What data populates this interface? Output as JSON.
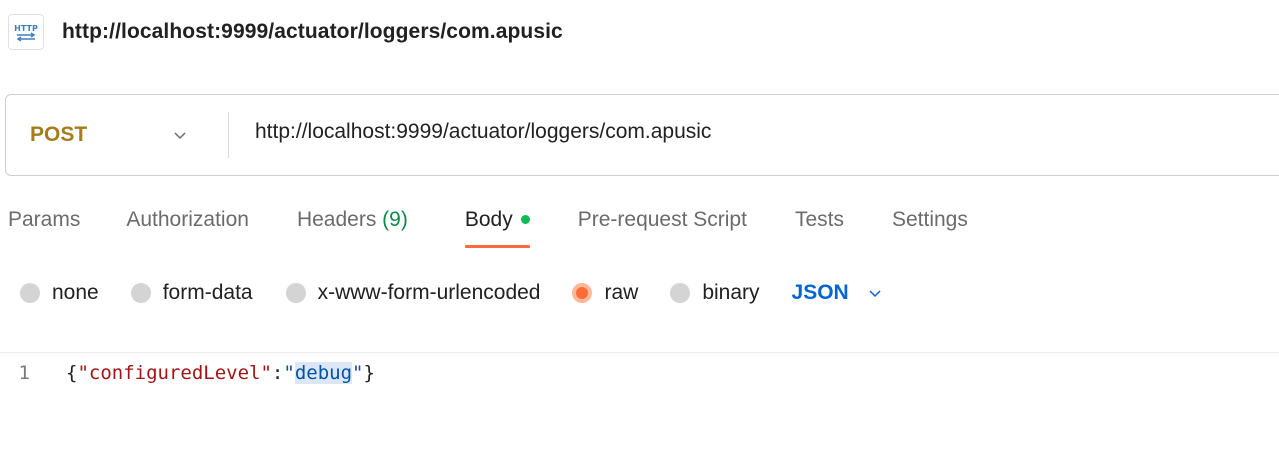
{
  "request": {
    "title": "http://localhost:9999/actuator/loggers/com.apusic",
    "icon": "http-request-icon",
    "method": "POST",
    "url": "http://localhost:9999/actuator/loggers/com.apusic"
  },
  "tabs": [
    {
      "label": "Params"
    },
    {
      "label": "Authorization"
    },
    {
      "label": "Headers",
      "count": "(9)"
    },
    {
      "label": "Body",
      "active": true,
      "indicator": "green-dot"
    },
    {
      "label": "Pre-request Script"
    },
    {
      "label": "Tests"
    },
    {
      "label": "Settings"
    }
  ],
  "body_types": [
    {
      "label": "none",
      "checked": false
    },
    {
      "label": "form-data",
      "checked": false
    },
    {
      "label": "x-www-form-urlencoded",
      "checked": false
    },
    {
      "label": "raw",
      "checked": true
    },
    {
      "label": "binary",
      "checked": false
    }
  ],
  "raw_format": "JSON",
  "editor": {
    "lines": [
      {
        "number": "1",
        "open_brace": "{",
        "key": "\"configuredLevel\"",
        "colon": ":",
        "quote_open": "\"",
        "value": "debug",
        "quote_close": "\"",
        "close_brace": "}"
      }
    ]
  },
  "colors": {
    "accent": "#ff6c37",
    "method_post": "#a67c1c",
    "link_blue": "#0265d2",
    "count_green": "#0c8a4c",
    "json_key": "#a31515",
    "json_value": "#0451a5"
  }
}
